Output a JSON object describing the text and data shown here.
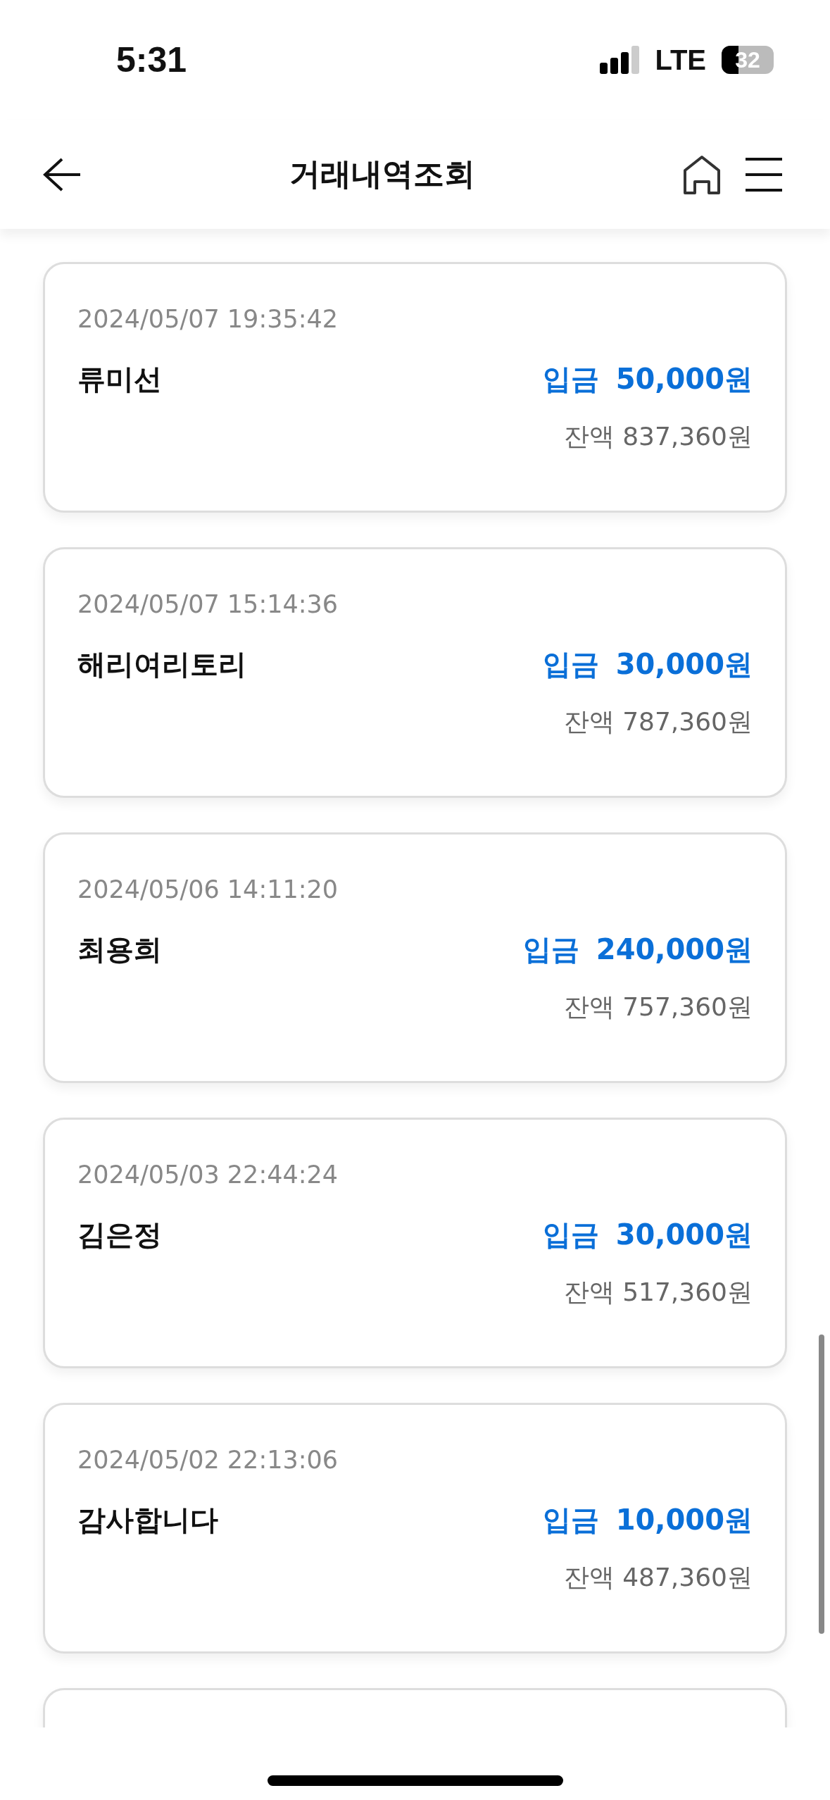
{
  "status_bar": {
    "time": "5:31",
    "network": "LTE",
    "battery": "32"
  },
  "header": {
    "title": "거래내역조회"
  },
  "transactions": [
    {
      "datetime": "2024/05/07 19:35:42",
      "name": "류미선",
      "kind": "deposit",
      "type_label": "입금",
      "amount": "50,000원",
      "balance": "잔액 837,360원"
    },
    {
      "datetime": "2024/05/07 15:14:36",
      "name": "해리여리토리",
      "kind": "deposit",
      "type_label": "입금",
      "amount": "30,000원",
      "balance": "잔액 787,360원"
    },
    {
      "datetime": "2024/05/06 14:11:20",
      "name": "최용희",
      "kind": "deposit",
      "type_label": "입금",
      "amount": "240,000원",
      "balance": "잔액 757,360원"
    },
    {
      "datetime": "2024/05/03 22:44:24",
      "name": "김은정",
      "kind": "deposit",
      "type_label": "입금",
      "amount": "30,000원",
      "balance": "잔액 517,360원"
    },
    {
      "datetime": "2024/05/02 22:13:06",
      "name": "감사합니다",
      "kind": "deposit",
      "type_label": "입금",
      "amount": "10,000원",
      "balance": "잔액 487,360원"
    }
  ]
}
